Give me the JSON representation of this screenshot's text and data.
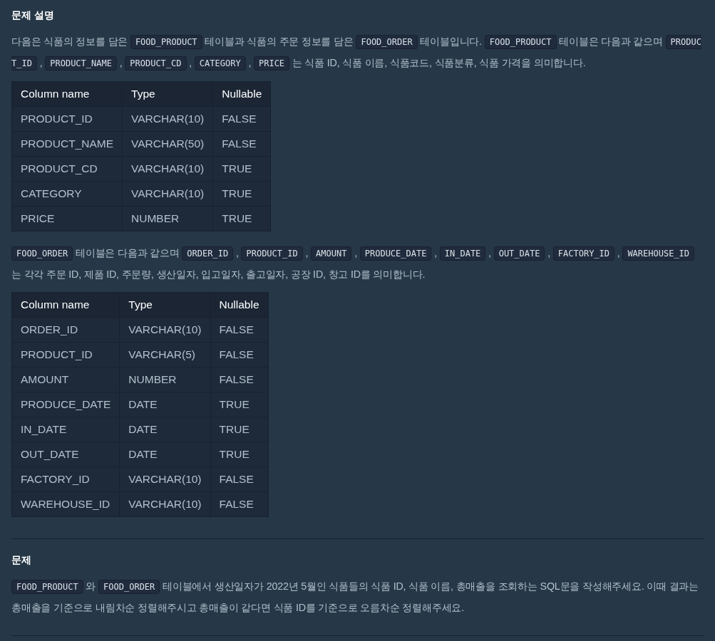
{
  "sections": [
    {
      "title": "문제 설명",
      "blocks": [
        {
          "kind": "paragraph",
          "segments": [
            {
              "kind": "text",
              "text": "다음은 식품의 정보를 담은 "
            },
            {
              "kind": "code",
              "text": "FOOD_PRODUCT"
            },
            {
              "kind": "text",
              "text": " 테이블과 식품의 주문 정보를 담은 "
            },
            {
              "kind": "code",
              "text": "FOOD_ORDER"
            },
            {
              "kind": "text",
              "text": " 테이블입니다. "
            },
            {
              "kind": "code",
              "text": "FOOD_PRODUCT"
            },
            {
              "kind": "text",
              "text": " 테이블은 다음과 같으며 "
            },
            {
              "kind": "code",
              "text": "PRODUCT_ID"
            },
            {
              "kind": "text",
              "text": " , "
            },
            {
              "kind": "code",
              "text": "PRODUCT_NAME"
            },
            {
              "kind": "text",
              "text": " , "
            },
            {
              "kind": "code",
              "text": "PRODUCT_CD"
            },
            {
              "kind": "text",
              "text": " , "
            },
            {
              "kind": "code",
              "text": "CATEGORY"
            },
            {
              "kind": "text",
              "text": " , "
            },
            {
              "kind": "code",
              "text": "PRICE"
            },
            {
              "kind": "text",
              "text": " 는 식품 ID, 식품 이름, 식품코드, 식품분류, 식품 가격을 의미합니다."
            }
          ]
        },
        {
          "kind": "table",
          "columns": [
            "Column name",
            "Type",
            "Nullable"
          ],
          "rows": [
            [
              "PRODUCT_ID",
              "VARCHAR(10)",
              "FALSE"
            ],
            [
              "PRODUCT_NAME",
              "VARCHAR(50)",
              "FALSE"
            ],
            [
              "PRODUCT_CD",
              "VARCHAR(10)",
              "TRUE"
            ],
            [
              "CATEGORY",
              "VARCHAR(10)",
              "TRUE"
            ],
            [
              "PRICE",
              "NUMBER",
              "TRUE"
            ]
          ]
        },
        {
          "kind": "paragraph",
          "segments": [
            {
              "kind": "code",
              "text": "FOOD_ORDER"
            },
            {
              "kind": "text",
              "text": " 테이블은 다음과 같으며 "
            },
            {
              "kind": "code",
              "text": "ORDER_ID"
            },
            {
              "kind": "text",
              "text": " , "
            },
            {
              "kind": "code",
              "text": "PRODUCT_ID"
            },
            {
              "kind": "text",
              "text": " , "
            },
            {
              "kind": "code",
              "text": "AMOUNT"
            },
            {
              "kind": "text",
              "text": " , "
            },
            {
              "kind": "code",
              "text": "PRODUCE_DATE"
            },
            {
              "kind": "text",
              "text": " , "
            },
            {
              "kind": "code",
              "text": "IN_DATE"
            },
            {
              "kind": "text",
              "text": " , "
            },
            {
              "kind": "code",
              "text": "OUT_DATE"
            },
            {
              "kind": "text",
              "text": " , "
            },
            {
              "kind": "code",
              "text": "FACTORY_ID"
            },
            {
              "kind": "text",
              "text": " , "
            },
            {
              "kind": "code",
              "text": "WAREHOUSE_ID"
            },
            {
              "kind": "text",
              "text": " 는 각각 주문 ID, 제품 ID, 주문량, 생산일자, 입고일자, 출고일자, 공장 ID, 창고 ID를 의미합니다."
            }
          ]
        },
        {
          "kind": "table",
          "columns": [
            "Column name",
            "Type",
            "Nullable"
          ],
          "rows": [
            [
              "ORDER_ID",
              "VARCHAR(10)",
              "FALSE"
            ],
            [
              "PRODUCT_ID",
              "VARCHAR(5)",
              "FALSE"
            ],
            [
              "AMOUNT",
              "NUMBER",
              "FALSE"
            ],
            [
              "PRODUCE_DATE",
              "DATE",
              "TRUE"
            ],
            [
              "IN_DATE",
              "DATE",
              "TRUE"
            ],
            [
              "OUT_DATE",
              "DATE",
              "TRUE"
            ],
            [
              "FACTORY_ID",
              "VARCHAR(10)",
              "FALSE"
            ],
            [
              "WAREHOUSE_ID",
              "VARCHAR(10)",
              "FALSE"
            ]
          ]
        }
      ]
    },
    {
      "title": "문제",
      "blocks": [
        {
          "kind": "paragraph",
          "segments": [
            {
              "kind": "code",
              "text": "FOOD_PRODUCT"
            },
            {
              "kind": "text",
              "text": " 와 "
            },
            {
              "kind": "code",
              "text": "FOOD_ORDER"
            },
            {
              "kind": "text",
              "text": " 테이블에서 생산일자가 2022년 5월인 식품들의 식품 ID, 식품 이름, 총매출을 조회하는 SQL문을 작성해주세요. 이때 결과는 총매출을 기준으로 내림차순 정렬해주시고 총매출이 같다면 식품 ID를 기준으로 오름차순 정렬해주세요."
            }
          ]
        }
      ]
    }
  ]
}
